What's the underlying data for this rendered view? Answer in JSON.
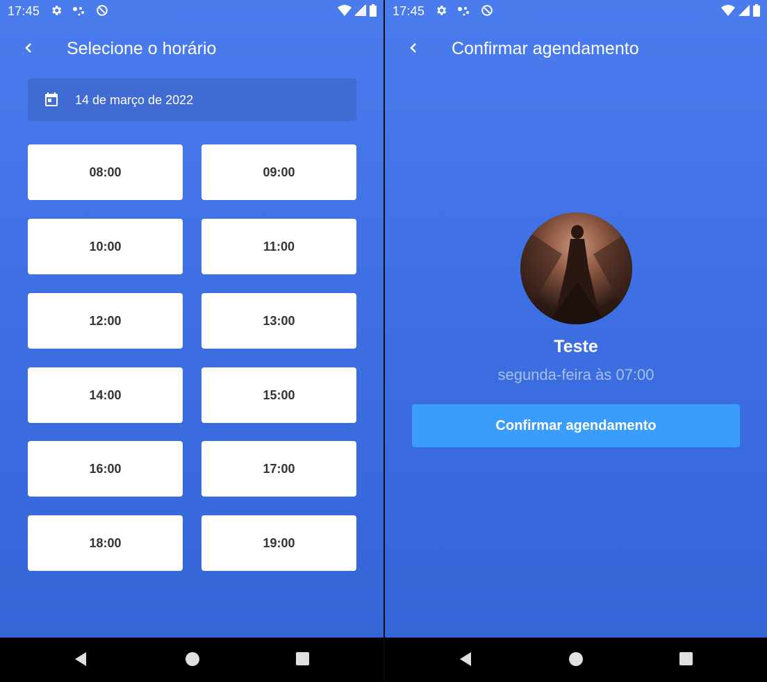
{
  "status_bar": {
    "time": "17:45"
  },
  "left": {
    "title": "Selecione o horário",
    "date": "14 de março de 2022",
    "times": [
      "08:00",
      "09:00",
      "10:00",
      "11:00",
      "12:00",
      "13:00",
      "14:00",
      "15:00",
      "16:00",
      "17:00",
      "18:00",
      "19:00"
    ]
  },
  "right": {
    "title": "Confirmar agendamento",
    "name": "Teste",
    "when": "segunda-feira às 07:00",
    "confirm_label": "Confirmar agendamento"
  },
  "icons": {
    "back": "chevron-left-icon",
    "calendar": "calendar-icon",
    "settings": "gear-icon",
    "nav_back": "triangle-back-icon",
    "nav_home": "circle-home-icon",
    "nav_recents": "square-recents-icon"
  },
  "colors": {
    "background_top": "#4b7cee",
    "background_bottom": "#3466d8",
    "date_box": "#3f6bd3",
    "confirm_button": "#3a9cfb",
    "time_text": "#333333",
    "subtitle": "#a9bfee"
  }
}
